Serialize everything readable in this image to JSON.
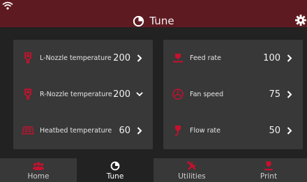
{
  "header": {
    "title": "Tune",
    "title_icon": "tune-gauge-icon"
  },
  "colors": {
    "accent": "#c8102e",
    "header_bg": "#5e1a21",
    "panel_bg": "#383838",
    "body_bg": "#222222"
  },
  "left_panel": [
    {
      "label": "L-Nozzle temperature",
      "value": "200",
      "icon": "nozzle-icon",
      "chevron": "chevron-right-icon"
    },
    {
      "label": "R-Nozzle temperature",
      "value": "200",
      "icon": "nozzle-icon",
      "chevron": "chevron-down-icon"
    },
    {
      "label": "Heatbed temperature",
      "value": "60",
      "icon": "heatbed-icon",
      "chevron": "chevron-right-icon"
    }
  ],
  "right_panel": [
    {
      "label": "Feed rate",
      "value": "100",
      "icon": "feed-rate-icon",
      "chevron": "chevron-right-icon"
    },
    {
      "label": "Fan speed",
      "value": "75",
      "icon": "fan-icon",
      "chevron": "chevron-right-icon"
    },
    {
      "label": "Flow rate",
      "value": "50",
      "icon": "flow-rate-icon",
      "chevron": "chevron-right-icon"
    }
  ],
  "nav": [
    {
      "label": "Home",
      "icon": "users-icon",
      "active": false
    },
    {
      "label": "Tune",
      "icon": "tune-gauge-icon",
      "active": true
    },
    {
      "label": "Utilities",
      "icon": "tools-icon",
      "active": false
    },
    {
      "label": "Print",
      "icon": "print-icon",
      "active": false
    }
  ]
}
